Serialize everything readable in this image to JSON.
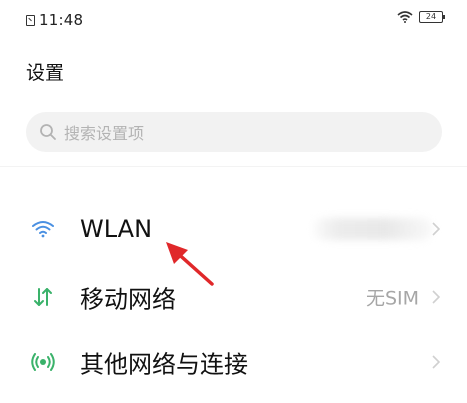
{
  "status_bar": {
    "time": "11:48",
    "battery_level": "24",
    "icons": [
      "sim-card-icon",
      "wifi-icon",
      "battery-icon"
    ]
  },
  "header": {
    "title": "设置"
  },
  "search": {
    "placeholder": "搜索设置项",
    "icon": "search-icon"
  },
  "settings": {
    "items": [
      {
        "label": "WLAN",
        "value": "",
        "icon": "wifi-icon",
        "value_obscured": true
      },
      {
        "label": "移动网络",
        "value": "无SIM",
        "icon": "mobile-data-icon"
      },
      {
        "label": "其他网络与连接",
        "value": "",
        "icon": "other-networks-icon"
      }
    ]
  },
  "colors": {
    "wlan_icon": "#4a90e2",
    "mobile_icon": "#3ab26a",
    "other_icon": "#3ab26a",
    "annotation_arrow": "#e0282a",
    "search_bg": "#f2f2f2",
    "secondary_text": "#a6a6a6"
  }
}
